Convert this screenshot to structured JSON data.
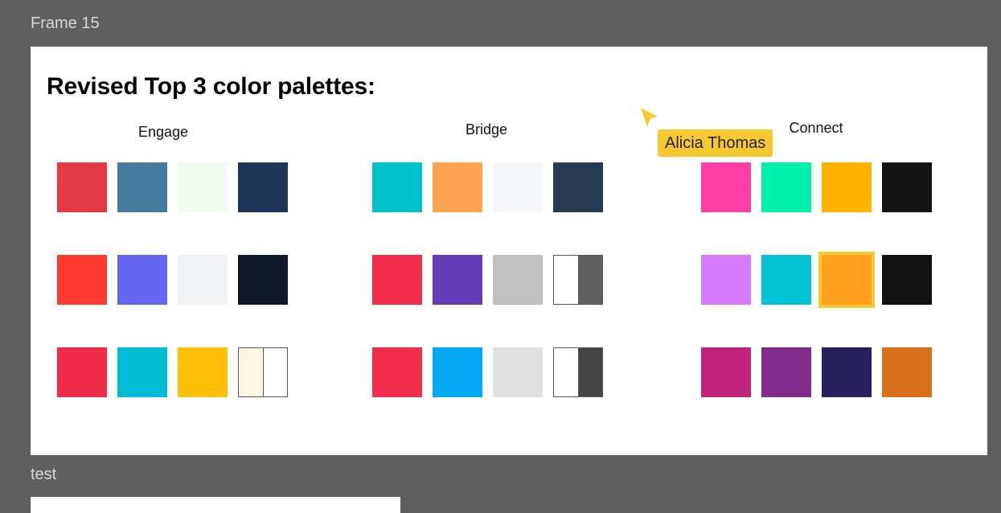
{
  "frames": {
    "frame_15_label": "Frame 15",
    "test_label": "test"
  },
  "title": "Revised Top 3 color palettes:",
  "groups": [
    {
      "name": "Engage",
      "rows": [
        [
          "#e63946",
          "#457b9d",
          "#f1faee",
          "#1d3557"
        ],
        [
          "#ff3b30",
          "#6366f1",
          "#f1f2f4",
          "#111827"
        ],
        [
          "#ef2d4b",
          "#00bcd4",
          "#ffc107",
          [
            "#fdf6e3",
            "#ffffff"
          ]
        ]
      ]
    },
    {
      "name": "Bridge",
      "rows": [
        [
          "#00c2cb",
          "#ffa552",
          "#f4f6fa",
          "#263a52"
        ],
        [
          "#f02d4a",
          "#673ab7",
          "#c0c0c0",
          [
            "#ffffff",
            "#5f5f5f"
          ]
        ],
        [
          "#f02d4a",
          "#03a9f4",
          "#e0e0e0",
          [
            "#ffffff",
            "#444444"
          ]
        ]
      ]
    },
    {
      "name": "Connect",
      "rows": [
        [
          "#ff3fa4",
          "#00f0aa",
          "#ffb400",
          "#141414"
        ],
        [
          "#d77bfd",
          "#00c2d4",
          "#ffa11c",
          "#121212"
        ],
        [
          "#c0247a",
          "#822b8c",
          "#27205c",
          "#d9701c"
        ]
      ]
    }
  ],
  "selected_swatch": {
    "group": "Connect",
    "row": 2,
    "column": 3
  },
  "collaborator": {
    "name": "Alicia Thomas",
    "color": "#f8c830"
  },
  "colors": {
    "canvas_background": "#5f5f5f",
    "frame_background": "#ffffff",
    "frame_label": "#d8d8d8",
    "selection_outline": "#f7c931"
  }
}
